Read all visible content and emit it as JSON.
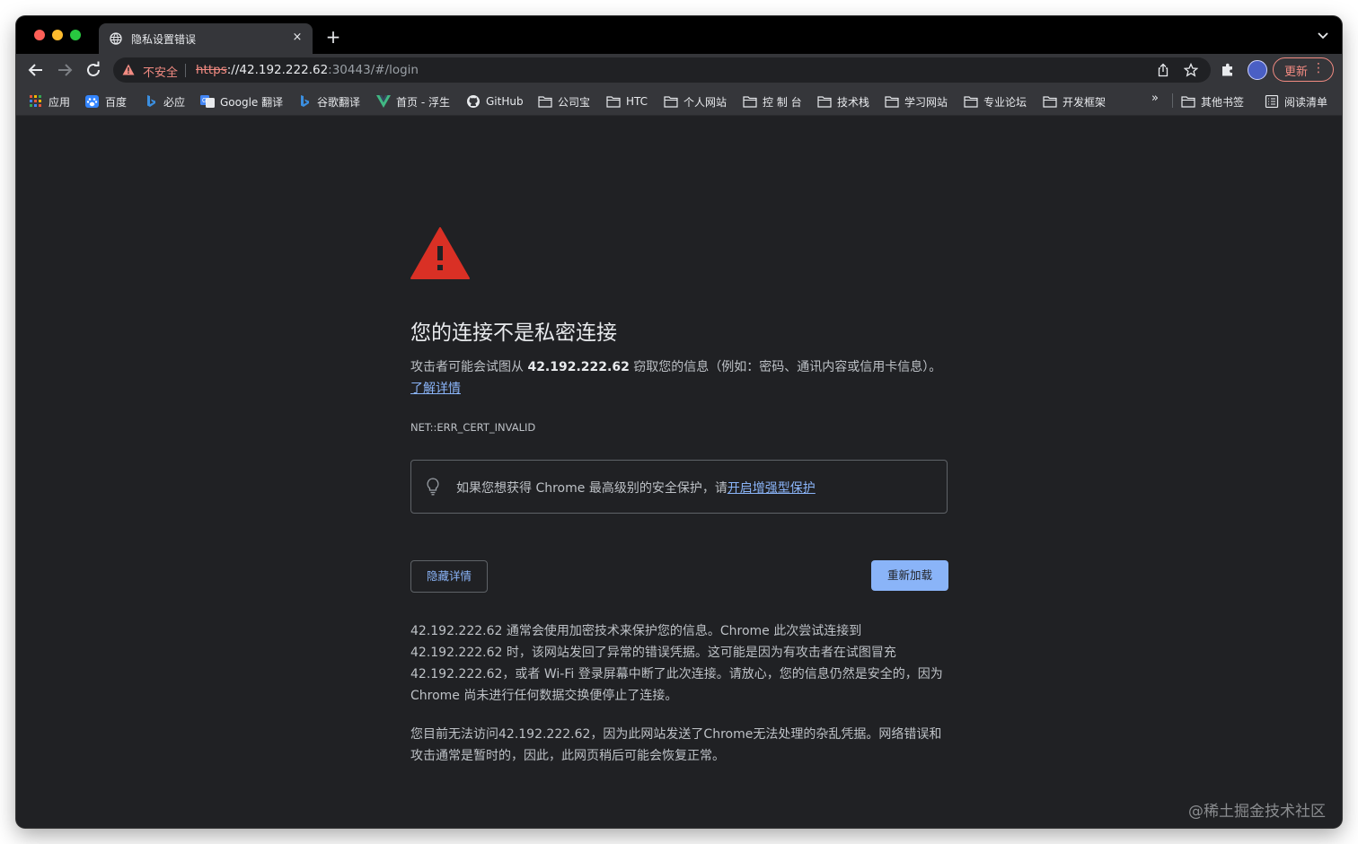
{
  "tab": {
    "title": "隐私设置错误",
    "close": "×",
    "new_tab": "+"
  },
  "omnibox": {
    "security_label": "不安全",
    "url_scheme": "https",
    "url_host": "://42.192.222.62",
    "url_rest": ":30443/#/login"
  },
  "toolbar": {
    "update_label": "更新",
    "menu_dots": "⋮"
  },
  "bookmarks": {
    "items": [
      {
        "label": "应用",
        "icon": "apps-grid-icon"
      },
      {
        "label": "百度",
        "icon": "baidu-icon"
      },
      {
        "label": "必应",
        "icon": "bing-icon"
      },
      {
        "label": "Google 翻译",
        "icon": "google-translate-icon"
      },
      {
        "label": "谷歌翻译",
        "icon": "bing-icon"
      },
      {
        "label": "首页 - 浮生",
        "icon": "vue-icon"
      },
      {
        "label": "GitHub",
        "icon": "github-icon"
      },
      {
        "label": "公司宝",
        "icon": "folder-icon"
      },
      {
        "label": "HTC",
        "icon": "folder-icon"
      },
      {
        "label": "个人网站",
        "icon": "folder-icon"
      },
      {
        "label": "控 制 台",
        "icon": "folder-icon"
      },
      {
        "label": "技术栈",
        "icon": "folder-icon"
      },
      {
        "label": "学习网站",
        "icon": "folder-icon"
      },
      {
        "label": "专业论坛",
        "icon": "folder-icon"
      },
      {
        "label": "开发框架",
        "icon": "folder-icon"
      }
    ],
    "more": "»",
    "other_bookmarks": "其他书签",
    "reading_list": "阅读清单"
  },
  "page": {
    "heading": "您的连接不是私密连接",
    "explanation_pre": "攻击者可能会试图从 ",
    "explanation_host": "42.192.222.62",
    "explanation_post": " 窃取您的信息（例如：密码、通讯内容或信用卡信息）。",
    "learn_more": "了解详情",
    "error_code": "NET::ERR_CERT_INVALID",
    "enhanced_text": "如果您想获得 Chrome 最高级别的安全保护，请",
    "enhanced_link": "开启增强型保护",
    "hide_details_button": "隐藏详情",
    "reload_button": "重新加载",
    "details_p1": "42.192.222.62 通常会使用加密技术来保护您的信息。Chrome 此次尝试连接到 42.192.222.62 时，该网站发回了异常的错误凭据。这可能是因为有攻击者在试图冒充 42.192.222.62，或者 Wi-Fi 登录屏幕中断了此次连接。请放心，您的信息仍然是安全的，因为 Chrome 尚未进行任何数据交换便停止了连接。",
    "details_p2": "您目前无法访问42.192.222.62，因为此网站发送了Chrome无法处理的杂乱凭据。网络错误和攻击通常是暂时的，因此，此网页稍后可能会恢复正常。"
  },
  "watermark": "@稀土掘金技术社区",
  "colors": {
    "warning_red": "#d93025",
    "link_blue": "#8ab4f8",
    "insecure_red": "#f28b82",
    "background": "#202124"
  }
}
